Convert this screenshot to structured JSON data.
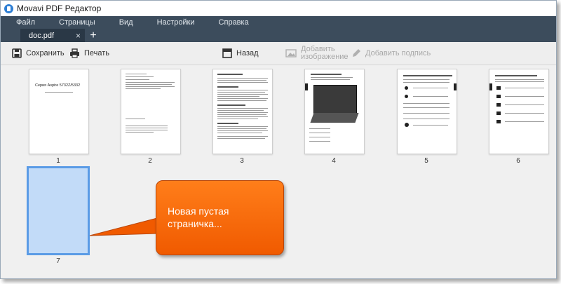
{
  "window": {
    "title": "Movavi PDF Редактор"
  },
  "menu": [
    "Файл",
    "Страницы",
    "Вид",
    "Настройки",
    "Справка"
  ],
  "tab": {
    "label": "doc.pdf",
    "close": "×",
    "add": "+"
  },
  "toolbar": {
    "save": "Сохранить",
    "print": "Печать",
    "back": "Назад",
    "add_image_line1": "Добавить",
    "add_image_line2": "изображение",
    "add_signature": "Добавить подпись"
  },
  "pages": [
    {
      "number": "1",
      "title": "Серия Aspire 5732Z/5332"
    },
    {
      "number": "2"
    },
    {
      "number": "3"
    },
    {
      "number": "4"
    },
    {
      "number": "5"
    },
    {
      "number": "6"
    },
    {
      "number": "7",
      "state": "blank"
    }
  ],
  "callout": {
    "line1": "Новая пустая",
    "line2": "страничка..."
  },
  "colors": {
    "menubar": "#3c4c5c",
    "callout": "#f56200",
    "selection": "#5a9be6"
  }
}
